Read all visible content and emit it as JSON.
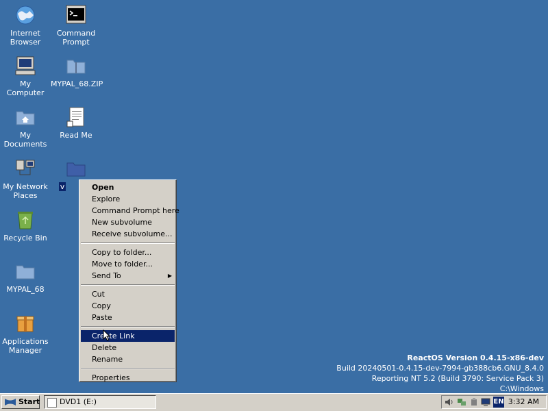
{
  "desktop": {
    "icons": [
      {
        "label": "Internet Browser",
        "line1": "Internet",
        "line2": "Browser"
      },
      {
        "label": "Command Prompt",
        "line1": "Command",
        "line2": "Prompt"
      },
      {
        "label": "My Computer",
        "line1": "My",
        "line2": "Computer"
      },
      {
        "label": "MYPAL_68.ZIP",
        "line1": "MYPAL_68.ZIP",
        "line2": ""
      },
      {
        "label": "My Documents",
        "line1": "My",
        "line2": "Documents"
      },
      {
        "label": "Read Me",
        "line1": "Read Me",
        "line2": ""
      },
      {
        "label": "My Network Places",
        "line1": "My Network",
        "line2": "Places"
      },
      {
        "label": "v",
        "line1": "v",
        "line2": ""
      },
      {
        "label": "Recycle Bin",
        "line1": "Recycle Bin",
        "line2": ""
      },
      {
        "label": "MYPAL_68",
        "line1": "MYPAL_68",
        "line2": ""
      },
      {
        "label": "Applications Manager",
        "line1": "Applications",
        "line2": "Manager"
      }
    ]
  },
  "context_menu": {
    "items": [
      "Open",
      "Explore",
      "Command Prompt here",
      "New subvolume",
      "Receive subvolume...",
      "Copy to folder...",
      "Move to folder...",
      "Send To",
      "Cut",
      "Copy",
      "Paste",
      "Create Link",
      "Delete",
      "Rename",
      "Properties"
    ],
    "highlighted": "Create Link"
  },
  "version": {
    "line1": "ReactOS Version 0.4.15-x86-dev",
    "line2": "Build 20240501-0.4.15-dev-7994-gb388cb6.GNU_8.4.0",
    "line3": "Reporting NT 5.2 (Build 3790: Service Pack 3)",
    "line4": "C:\\Windows"
  },
  "taskbar": {
    "start_label": "Start",
    "task_label": "DVD1 (E:)",
    "lang": "EN",
    "clock": "3:32 AM"
  },
  "colors": {
    "desktop": "#3a6ea5",
    "highlight": "#0a246a",
    "face": "#d4d0c8"
  }
}
